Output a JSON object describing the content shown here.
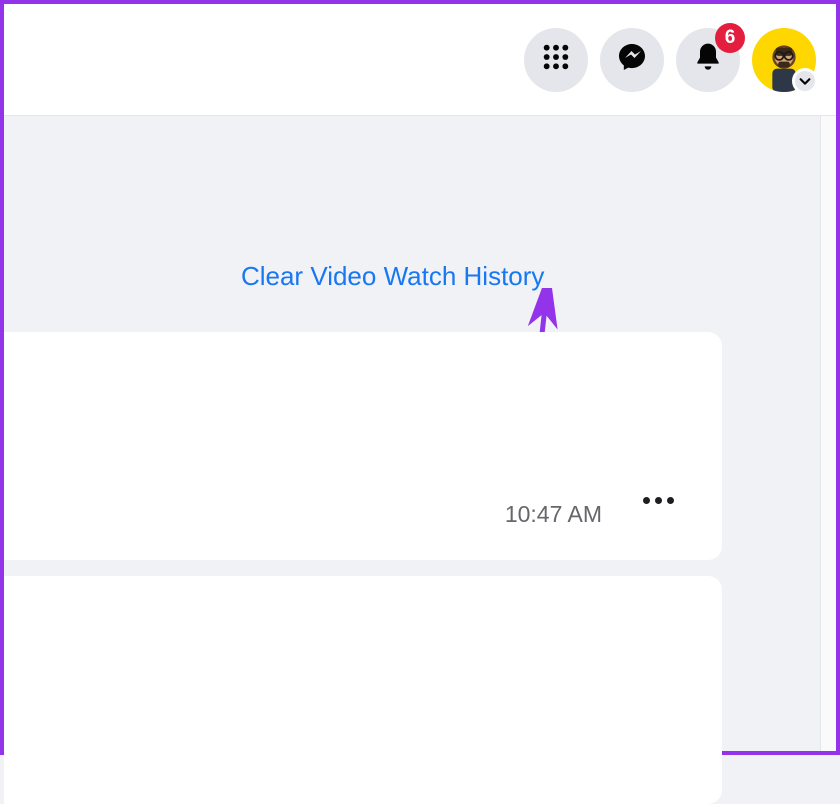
{
  "header": {
    "notifications_badge": "6"
  },
  "main": {
    "clear_link_label": "Clear Video Watch History",
    "card1": {
      "timestamp": "10:47 AM"
    }
  },
  "colors": {
    "link": "#1877f2",
    "badge": "#e41e3f",
    "border": "#9333ea"
  }
}
